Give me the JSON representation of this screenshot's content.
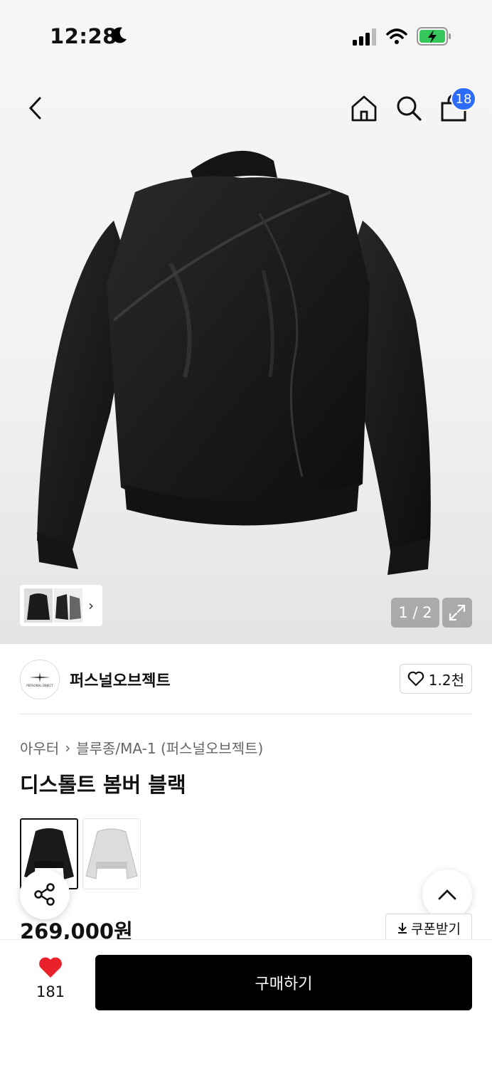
{
  "status_bar": {
    "time": "12:28"
  },
  "nav": {
    "cart_count": "18"
  },
  "gallery": {
    "page_indicator": "1 / 2"
  },
  "brand": {
    "name": "퍼스널오브젝트",
    "logo_text": "PERSONAL OBJECT",
    "likes": "1.2천"
  },
  "breadcrumb": {
    "category": "아우터",
    "subcategory": "블루종/MA-1 (퍼스널오브젝트)"
  },
  "product": {
    "title": "디스톨트 봄버 블랙",
    "price": "269,000원"
  },
  "coupon": {
    "label": "쿠폰받기"
  },
  "bottom": {
    "wish_count": "181",
    "buy_label": "구매하기"
  },
  "colors": {
    "badge": "#2d6cf6",
    "heart": "#e8212b",
    "buy_button": "#000000"
  }
}
